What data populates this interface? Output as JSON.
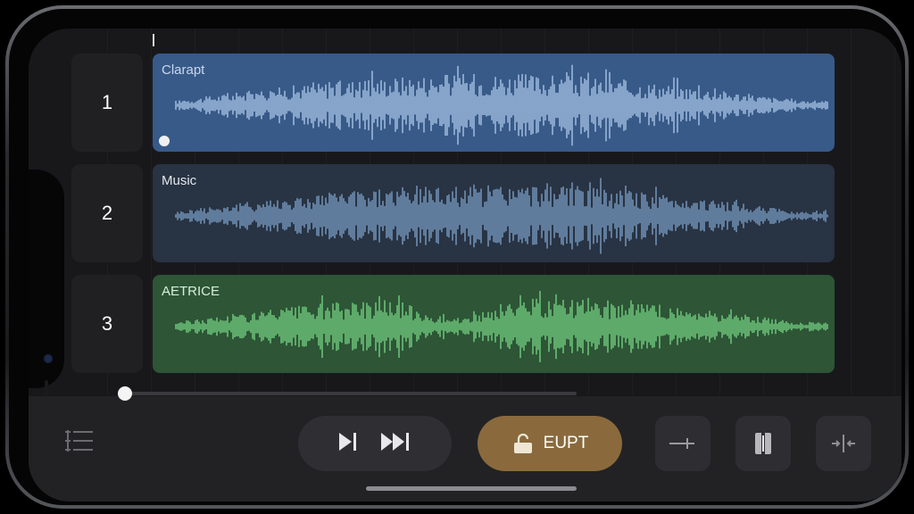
{
  "tracks": [
    {
      "number": "1",
      "label": "Clarapt",
      "color": "#385a88",
      "wave_color": "#9bb6da",
      "label_color": "#c8d7ee",
      "loop_toggle": true
    },
    {
      "number": "2",
      "label": "Music",
      "color": "#283343",
      "wave_color": "#6f8fb2",
      "label_color": "#e4e8ee",
      "loop_toggle": false
    },
    {
      "number": "3",
      "label": "AETRICE",
      "color": "#2d5536",
      "wave_color": "#6bbf78",
      "label_color": "#d7efd9",
      "loop_toggle": false
    }
  ],
  "toolbar": {
    "edit_label": "EUPT",
    "accent_color": "#8a6a3c"
  },
  "icons": {
    "track_list": "list-icon",
    "play": "play-icon",
    "skip_forward": "skip-forward-icon",
    "lock": "unlock-icon",
    "move": "arrow-right-icon",
    "split": "split-icon",
    "trim": "trim-icon"
  }
}
